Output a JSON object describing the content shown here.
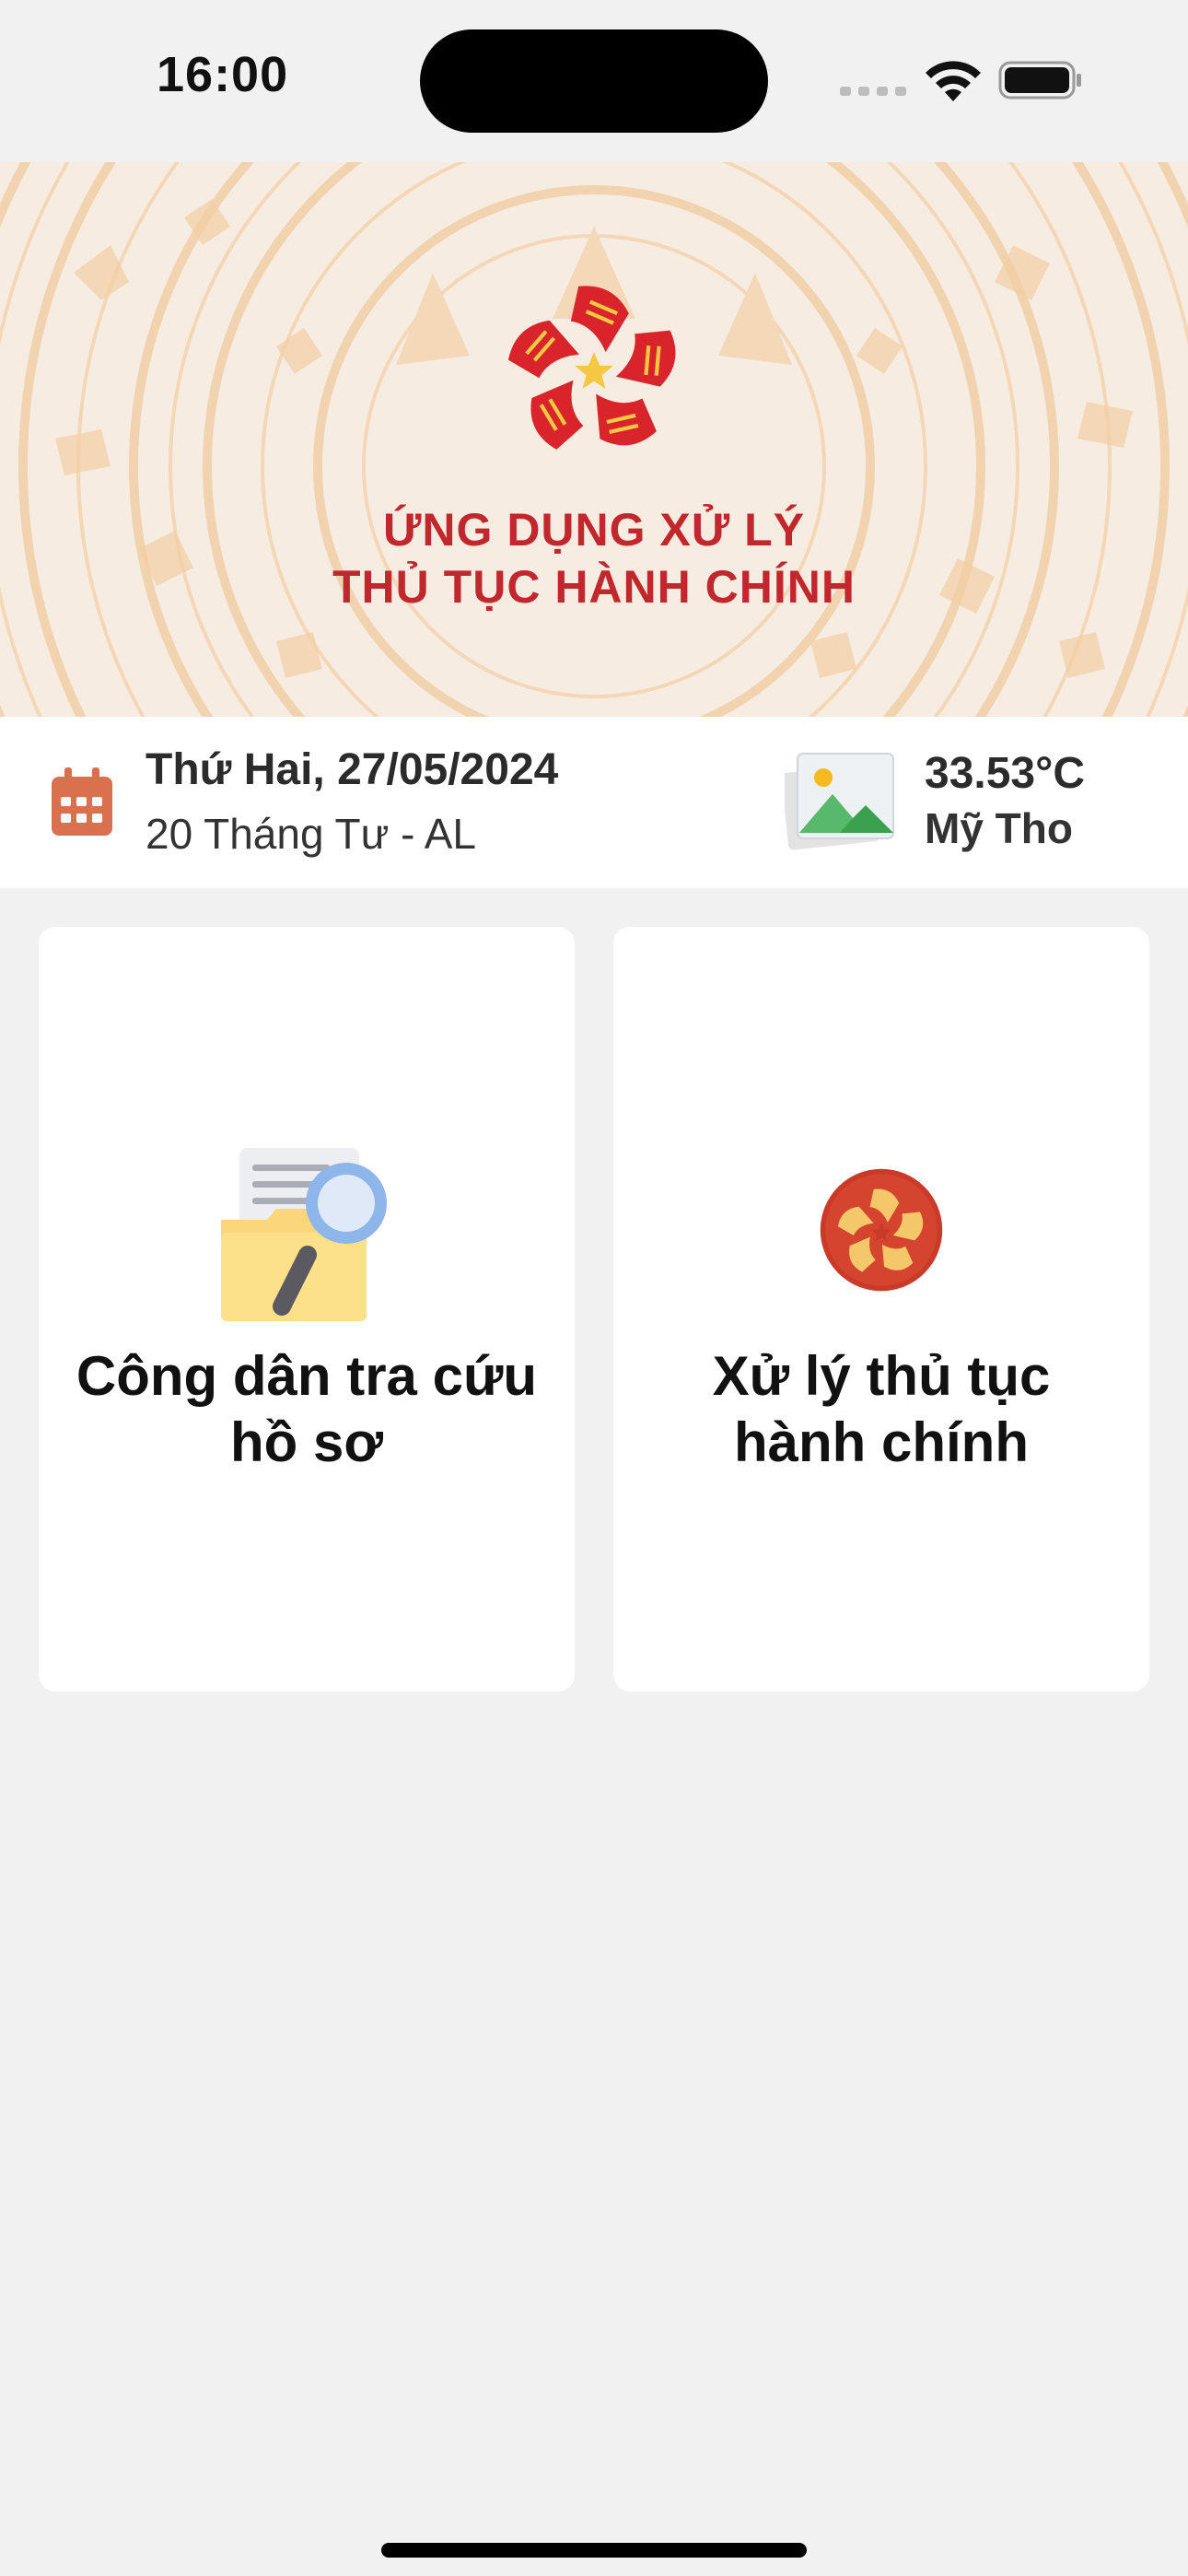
{
  "status_bar": {
    "time": "16:00"
  },
  "banner": {
    "title_line1": "ỨNG DỤNG XỬ LÝ",
    "title_line2": "THỦ TỤC HÀNH CHÍNH",
    "colors": {
      "title": "#c0282e",
      "pattern": "#f0c89a",
      "background": "#f6ece2"
    }
  },
  "info": {
    "date": "Thứ Hai, 27/05/2024",
    "lunar_date": "20 Tháng Tư - AL",
    "temperature": "33.53°C",
    "city": "Mỹ Tho",
    "calendar_icon": "calendar-icon",
    "weather_icon": "image-placeholder-icon"
  },
  "cards": [
    {
      "label_line1": "Công dân tra cứu",
      "label_line2": "hồ sơ",
      "icon": "folder-search-icon"
    },
    {
      "label_line1": "Xử lý thủ tục",
      "label_line2": "hành chính",
      "icon": "emblem-icon"
    }
  ]
}
